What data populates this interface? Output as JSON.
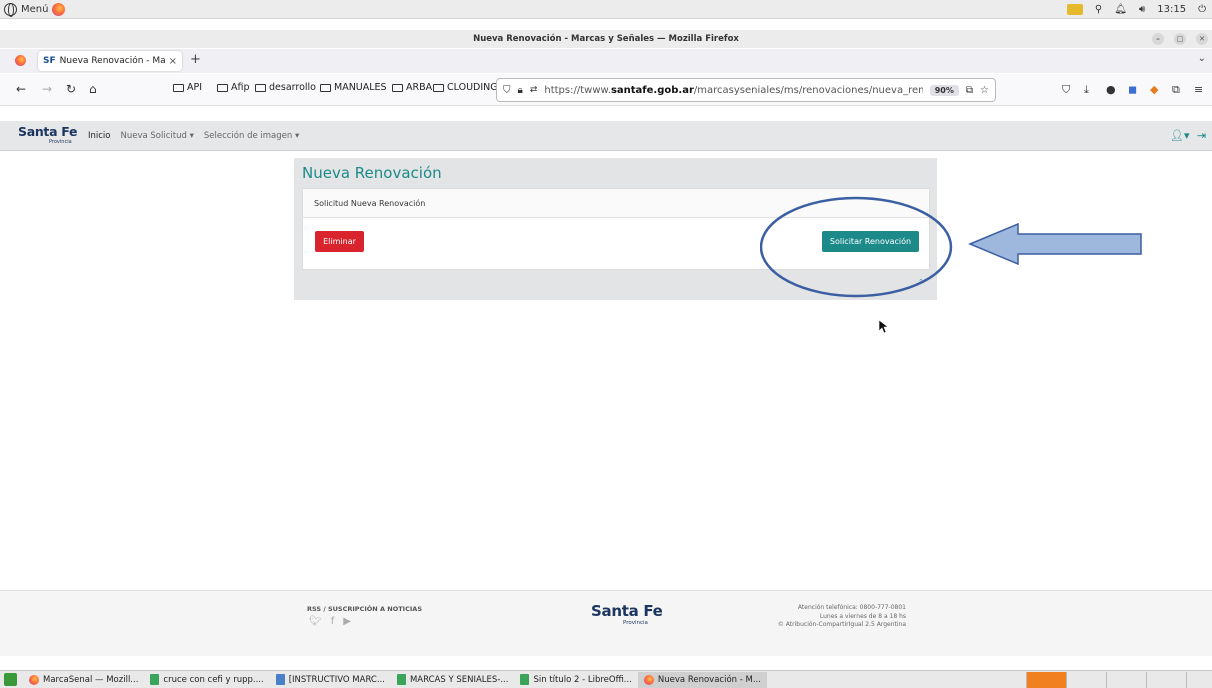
{
  "os_panel": {
    "menu_label": "Menú",
    "time": "13:15"
  },
  "window": {
    "title": "Nueva Renovación - Marcas y Señales — Mozilla Firefox"
  },
  "tab": {
    "sf_badge": "SF",
    "title": "Nueva Renovación - Marc",
    "close": "×",
    "new_tab": "+"
  },
  "bookmarks": [
    "API",
    "Afip",
    "desarrollo",
    "MANUALES",
    "ARBA",
    "CLOUDING-IO"
  ],
  "url": {
    "prefix": "https://twww.",
    "domain": "santafe.gob.ar",
    "path": "/marcasyseniales/ms/renovaciones/nueva_renovacion/",
    "zoom": "90%"
  },
  "site": {
    "logo": "Santa Fe",
    "logo_sub": "Provincia",
    "nav": {
      "home": "Inicio",
      "new_request": "Nueva Solicitud",
      "image_select": "Selección de imagen"
    }
  },
  "main": {
    "title": "Nueva Renovación",
    "section_header": "Solicitud Nueva Renovación",
    "delete_button": "Eliminar",
    "submit_button": "Solicitar Renovación"
  },
  "footer": {
    "rss": "RSS / SUSCRIPCIÓN A NOTICIAS",
    "logo": "Santa Fe",
    "logo_sub": "Provincia",
    "phone": "Atención telefónica: 0800-777-0801",
    "hours": "Lunes a viernes de 8 a 18 hs",
    "license": "Atribución-CompartirIgual 2.5 Argentina"
  },
  "taskbar": {
    "items": [
      "MarcaSenal — Mozill...",
      "cruce con cefi y rupp....",
      "[INSTRUCTIVO MARC...",
      "MARCAS Y SENIALES-...",
      "Sin título 2 - LibreOffi...",
      "Nueva Renovación - M..."
    ]
  },
  "colors": {
    "accent": "#1d8a8a",
    "danger": "#d9232d",
    "brand": "#1d3660",
    "annotation": "#3b5fa3"
  }
}
